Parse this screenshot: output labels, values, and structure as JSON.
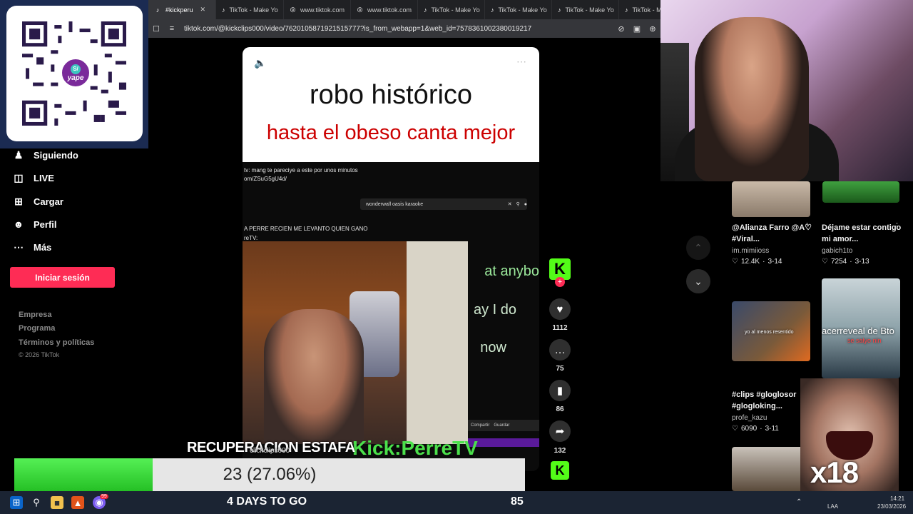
{
  "browser": {
    "tabs": [
      {
        "label": "#kickperu",
        "active": true
      },
      {
        "label": "TikTok - Make Yo",
        "active": false
      },
      {
        "label": "www.tiktok.com",
        "active": false
      },
      {
        "label": "www.tiktok.com",
        "active": false
      },
      {
        "label": "TikTok - Make Yo",
        "active": false
      },
      {
        "label": "TikTok - Make Yo",
        "active": false
      },
      {
        "label": "TikTok - Make Yo",
        "active": false
      },
      {
        "label": "TikTok - Make",
        "active": false
      }
    ],
    "url": "tiktok.com/@kickclips000/video/7620105871921515777?is_from_webapp=1&web_id=7578361002380019217"
  },
  "qr": {
    "brand": "yape",
    "currency": "S/"
  },
  "sidebar": {
    "items": [
      {
        "label": "Siguiendo",
        "icon": "user-follow-icon"
      },
      {
        "label": "LIVE",
        "icon": "live-icon"
      },
      {
        "label": "Cargar",
        "icon": "upload-icon"
      },
      {
        "label": "Perfil",
        "icon": "profile-icon"
      },
      {
        "label": "Más",
        "icon": "more-icon"
      }
    ],
    "login_button": "Iniciar sesión",
    "footer_links": [
      "Empresa",
      "Programa",
      "Términos y políticas"
    ],
    "copyright": "© 2026 TikTok"
  },
  "video": {
    "caption_line1": "robo histórico",
    "caption_line2": "hasta el obeso canta mejor",
    "chat_lines": [
      "tv: mang te pareciye a este por unos minutos",
      "om/ZSuG5gU4d/",
      "A PERRE RECIEN ME LEVANTO QUIEN GANO",
      "reTV:"
    ],
    "inner_search": "wonderwall oasis karaoke",
    "lyrics": [
      "at anybo",
      "ay I do",
      "now"
    ],
    "streamer_tag": "Kick:PerreTV",
    "inner_buttons": [
      "Compartir",
      "Guardar"
    ]
  },
  "actions": {
    "likes": "1112",
    "comments": "75",
    "saves": "86",
    "shares": "132"
  },
  "recommendations": [
    {
      "title": "@Alianza Farro @A♡ #Viral...",
      "author": "im.mimiioss",
      "views": "12.4K",
      "date": "3-14"
    },
    {
      "title": "Déjame estar contigo mi amor...",
      "author": "gabich1to",
      "views": "7254",
      "date": "3-13"
    },
    {
      "title": "#clips #gloglosor #glogloking...",
      "author": "profe_kazu",
      "views": "6090",
      "date": "3-11"
    }
  ],
  "thumb_overlays": [
    "yo al menos resentido",
    "acerreveal de Bto",
    "se salyo nin"
  ],
  "donation": {
    "goal_title": "RECUPERACION ESTAFA",
    "goal_value": "23 (27.06%)",
    "goal_fraction": 0.2706,
    "overlay_name": "clickclips000",
    "days_label": "4 DAYS TO GO",
    "counter": "85"
  },
  "meme": {
    "label": "x18"
  },
  "taskbar": {
    "lang": "LAA",
    "time": "14:21",
    "date": "23/03/2026",
    "badge": "99"
  },
  "colors": {
    "tiktok_red": "#fe2c55",
    "kick_green": "#53fc18",
    "goal_green": "#3bd83b"
  }
}
